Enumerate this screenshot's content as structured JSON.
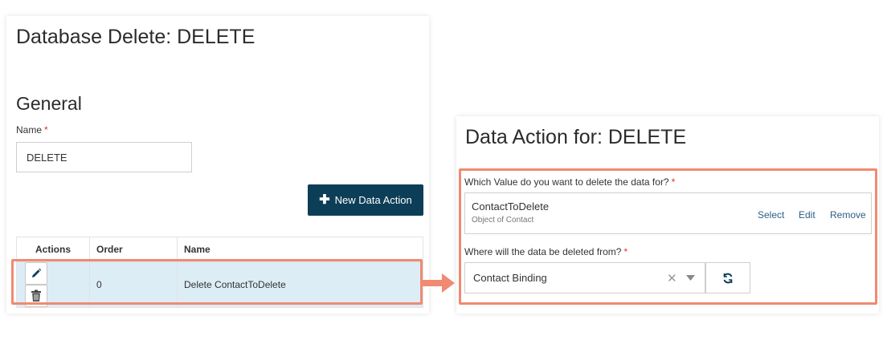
{
  "left_panel": {
    "title": "Database Delete: DELETE",
    "section_title": "General",
    "name_label": "Name",
    "required_mark": "*",
    "name_value": "DELETE",
    "new_action_button": {
      "icon": "plus-icon",
      "label": "New Data Action"
    },
    "table": {
      "headers": [
        "Actions",
        "Order",
        "Name"
      ],
      "rows": [
        {
          "order": "0",
          "name": "Delete ContactToDelete"
        }
      ],
      "row_icons": [
        "pencil-icon",
        "trash-icon"
      ]
    }
  },
  "right_panel": {
    "title": "Data Action for: DELETE",
    "value_question": "Which Value do you want to delete the data for?",
    "required_mark": "*",
    "value_name": "ContactToDelete",
    "value_type": "Object of Contact",
    "value_links": {
      "select": "Select",
      "edit": "Edit",
      "remove": "Remove"
    },
    "source_question": "Where will the data be deleted from?",
    "source_value": "Contact Binding",
    "source_icons": [
      "clear-icon",
      "dropdown-caret-icon",
      "refresh-icon"
    ]
  },
  "colors": {
    "primary_button": "#0d3e57",
    "highlight_outline": "#f08a72",
    "selected_row": "#dcedf6",
    "required": "#d9342b"
  }
}
